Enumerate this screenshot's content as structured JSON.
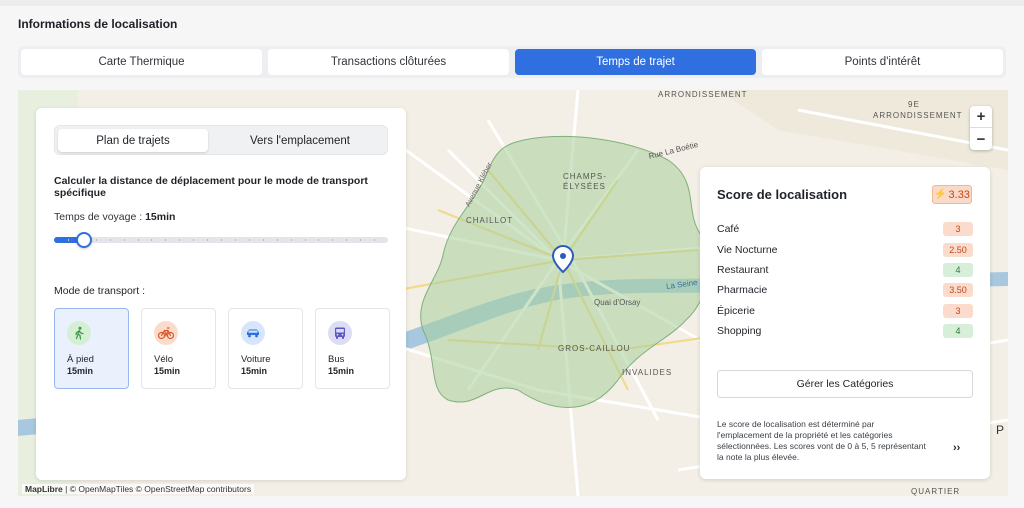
{
  "section_title": "Informations de localisation",
  "tabs": [
    {
      "label": "Carte Thermique",
      "active": false
    },
    {
      "label": "Transactions clôturées",
      "active": false
    },
    {
      "label": "Temps de trajet",
      "active": true
    },
    {
      "label": "Points d'intérêt",
      "active": false
    }
  ],
  "map": {
    "labels": [
      "ARRONDISSEMENT",
      "9E",
      "ARRONDISSEMENT",
      "Rue La Boétie",
      "CHAMPS-",
      "ÉLYSÉES",
      "CHAILLOT",
      "Avenue Kléber",
      "La Seine",
      "Quai d'Orsay",
      "GROS-CAILLOU",
      "INVALIDES",
      "QUARTIER",
      "P"
    ],
    "zoom_in": "+",
    "zoom_out": "−",
    "attribution_brand": "MapLibre",
    "attribution_rest": "| © OpenMapTiles © OpenStreetMap contributors"
  },
  "route_panel": {
    "segment": {
      "active": "Plan de trajets",
      "other": "Vers l'emplacement"
    },
    "calc_title": "Calculer la distance de déplacement pour le mode de transport spécifique",
    "travel_label": "Temps de voyage : ",
    "travel_value": "15min",
    "slider_fraction": 0.09,
    "mode_label": "Mode de transport :",
    "modes": [
      {
        "name": "À pied",
        "duration": "15min",
        "icon": "walk-icon",
        "color": "#d4efd4",
        "stroke": "#3f9a4a",
        "active": true
      },
      {
        "name": "Vélo",
        "duration": "15min",
        "icon": "bike-icon",
        "color": "#fbdccc",
        "stroke": "#d9572a",
        "active": false
      },
      {
        "name": "Voiture",
        "duration": "15min",
        "icon": "car-icon",
        "color": "#d8e6fb",
        "stroke": "#2f6fe0",
        "active": false
      },
      {
        "name": "Bus",
        "duration": "15min",
        "icon": "bus-icon",
        "color": "#dcdcf5",
        "stroke": "#5a57c4",
        "active": false
      }
    ]
  },
  "score_panel": {
    "title": "Score de localisation",
    "score": "3.33",
    "categories": [
      {
        "label": "Café",
        "value": "3",
        "tone": "orange"
      },
      {
        "label": "Vie Nocturne",
        "value": "2.50",
        "tone": "orange"
      },
      {
        "label": "Restaurant",
        "value": "4",
        "tone": "green"
      },
      {
        "label": "Pharmacie",
        "value": "3.50",
        "tone": "orange"
      },
      {
        "label": "Épicerie",
        "value": "3",
        "tone": "orange"
      },
      {
        "label": "Shopping",
        "value": "4",
        "tone": "green"
      }
    ],
    "manage_label": "Gérer les Catégories",
    "description": "Le score de localisation est déterminé par l'emplacement de la propriété et les catégories sélectionnées. Les scores vont de 0 à 5, 5 représentant la note la plus élevée.",
    "more": "››"
  },
  "colors": {
    "accent": "#2f6fe0",
    "isochrone": "#a8cf9a",
    "water": "#a7c8df",
    "badge_orange": "#c4461a",
    "badge_green": "#2c7a36"
  }
}
